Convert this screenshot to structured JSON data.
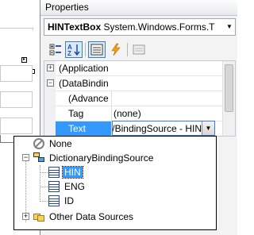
{
  "properties_window": {
    "title": "Properties",
    "object_selector": {
      "name": "HINTextBox",
      "type": "System.Windows.Forms.T"
    },
    "toolbar": [
      {
        "name": "categorized-icon",
        "pressed": false
      },
      {
        "name": "alphabetical-icon",
        "pressed": true
      },
      {
        "name": "properties-icon",
        "pressed": true
      },
      {
        "name": "events-icon",
        "pressed": false
      },
      {
        "name": "property-pages-icon",
        "pressed": false
      }
    ],
    "grid_rows": [
      {
        "name": "(Application",
        "value": "",
        "expander": "+",
        "indent": 0
      },
      {
        "name": "(DataBindin",
        "value": "",
        "expander": "−",
        "indent": 0
      },
      {
        "name": "(Advance",
        "value": "",
        "expander": "",
        "indent": 1
      },
      {
        "name": "Tag",
        "value": "(none)",
        "expander": "",
        "indent": 1
      },
      {
        "name": "Text",
        "value": "",
        "expander": "",
        "indent": 1,
        "selected": true
      }
    ],
    "value_editor": {
      "text": "/BindingSource - HIN"
    }
  },
  "binding_dropdown": {
    "items": [
      {
        "label": "None",
        "icon": "none-icon"
      },
      {
        "label": "DictionaryBindingSource",
        "icon": "binding-source-icon"
      },
      {
        "label": "HIN",
        "icon": "field-icon",
        "selected": true
      },
      {
        "label": "ENG",
        "icon": "field-icon"
      },
      {
        "label": "ID",
        "icon": "field-icon"
      },
      {
        "label": "Other Data Sources",
        "icon": "folder-icon"
      }
    ]
  },
  "colors": {
    "selection": "#3399ff",
    "window_bg": "#f3f3f3",
    "edit_border": "#3d7bd6"
  }
}
